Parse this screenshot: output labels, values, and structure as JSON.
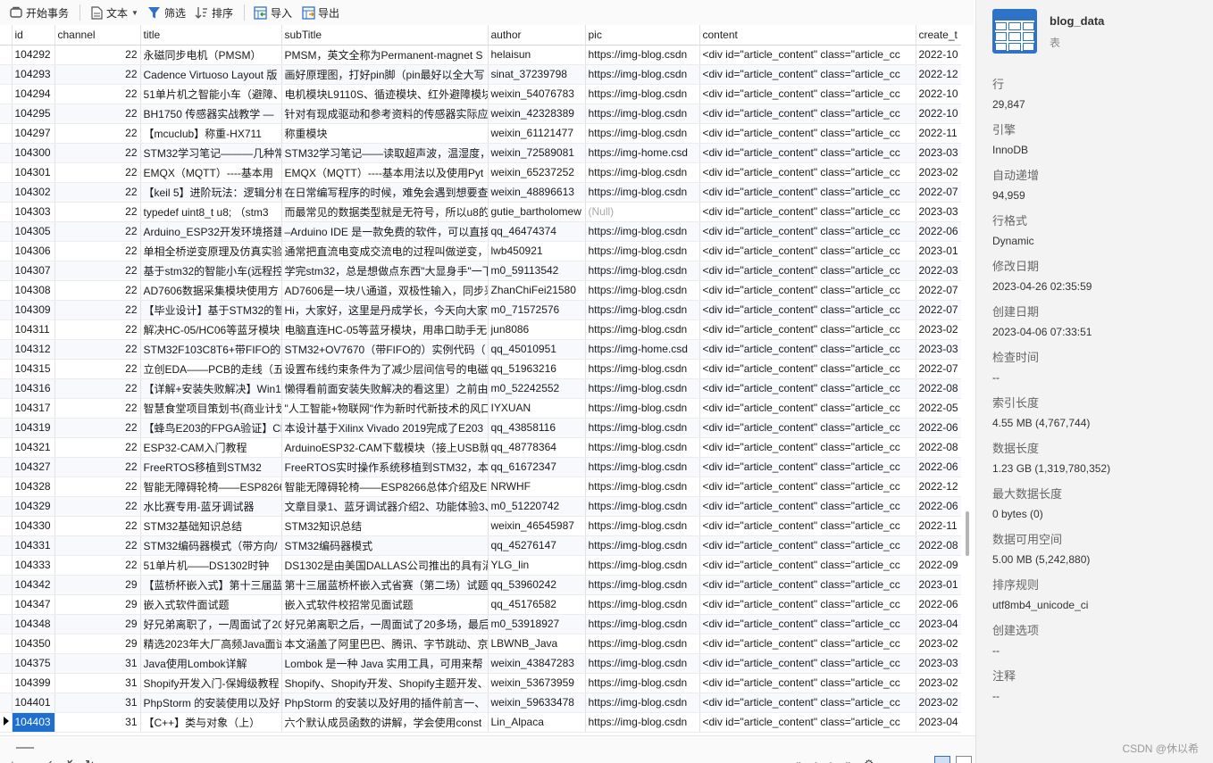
{
  "toolbar": {
    "begin_tx": "开始事务",
    "text": "文本",
    "filter": "筛选",
    "sort": "排序",
    "import": "导入",
    "export": "导出"
  },
  "grid": {
    "columns": [
      "id",
      "channel",
      "title",
      "subTitle",
      "author",
      "pic",
      "content",
      "create_t"
    ],
    "rows": [
      [
        "104292",
        "22",
        "永磁同步电机（PMSM）",
        "PMSM，英文全称为Permanent-magnet S",
        "helaisun",
        "https://img-blog.csdn",
        "<div id=\"article_content\" class=\"article_cc",
        "2022-10"
      ],
      [
        "104293",
        "22",
        "Cadence Virtuoso Layout 版",
        "画好原理图，打好pin脚（pin最好以全大写",
        "sinat_37239798",
        "https://img-blog.csdn",
        "<div id=\"article_content\" class=\"article_cc",
        "2022-12"
      ],
      [
        "104294",
        "22",
        "51单片机之智能小车（避障、",
        "电机模块L9110S、循迹模块、红外避障模块",
        "weixin_54076783",
        "https://img-blog.csdn",
        "<div id=\"article_content\" class=\"article_cc",
        "2022-10"
      ],
      [
        "104295",
        "22",
        "BH1750 传感器实战教学 —",
        "针对有现成驱动和参考资料的传感器实际应",
        "weixin_42328389",
        "https://img-blog.csdn",
        "<div id=\"article_content\" class=\"article_cc",
        "2022-10"
      ],
      [
        "104297",
        "22",
        "【mcuclub】称重-HX711",
        "称重模块",
        "weixin_61121477",
        "https://img-blog.csdn",
        "<div id=\"article_content\" class=\"article_cc",
        "2022-11"
      ],
      [
        "104300",
        "22",
        "STM32学习笔记———几种常",
        "STM32学习笔记——读取超声波，温湿度，",
        "weixin_72589081",
        "https://img-home.csd",
        "<div id=\"article_content\" class=\"article_cc",
        "2023-03"
      ],
      [
        "104301",
        "22",
        "EMQX（MQTT）----基本用",
        "EMQX（MQTT）----基本用法以及使用Pyt",
        "weixin_65237252",
        "https://img-blog.csdn",
        "<div id=\"article_content\" class=\"article_cc",
        "2023-02"
      ],
      [
        "104302",
        "22",
        "【keil 5】进阶玩法：逻辑分析",
        "在日常编写程序的时候，难免会遇到想要查",
        "weixin_48896613",
        "https://img-blog.csdn",
        "<div id=\"article_content\" class=\"article_cc",
        "2022-07"
      ],
      [
        "104303",
        "22",
        "typedef uint8_t u8; （stm3",
        "而最常见的数据类型就是无符号，所以u8的",
        "gutie_bartholomew",
        "(Null)",
        "<div id=\"article_content\" class=\"article_cc",
        "2023-03"
      ],
      [
        "104305",
        "22",
        "Arduino_ESP32开发环境搭建",
        "–Arduino IDE 是一款免费的软件，可以直接",
        "qq_46474374",
        "https://img-blog.csdn",
        "<div id=\"article_content\" class=\"article_cc",
        "2022-06"
      ],
      [
        "104306",
        "22",
        "单相全桥逆变原理及仿真实验",
        "通常把直流电变成交流电的过程叫做逆变，",
        "lwb450921",
        "https://img-blog.csdn",
        "<div id=\"article_content\" class=\"article_cc",
        "2023-01"
      ],
      [
        "104307",
        "22",
        "基于stm32的智能小车(远程控",
        "学完stm32，总是想做点东西\"大显身手\"一下",
        "m0_59113542",
        "https://img-blog.csdn",
        "<div id=\"article_content\" class=\"article_cc",
        "2022-03"
      ],
      [
        "104308",
        "22",
        "AD7606数据采集模块使用方",
        "AD7606是一块八通道，双极性输入，同步采",
        "ZhanChiFei21580",
        "https://img-blog.csdn",
        "<div id=\"article_content\" class=\"article_cc",
        "2022-07"
      ],
      [
        "104309",
        "22",
        "【毕业设计】基于STM32的智",
        "Hi，大家好，这里是丹成学长，今天向大家",
        "m0_71572576",
        "https://img-blog.csdn",
        "<div id=\"article_content\" class=\"article_cc",
        "2022-07"
      ],
      [
        "104311",
        "22",
        "解决HC-05/HC06等蓝牙模块",
        "电脑直连HC-05等蓝牙模块，用串口助手无",
        "jun8086",
        "https://img-blog.csdn",
        "<div id=\"article_content\" class=\"article_cc",
        "2023-02"
      ],
      [
        "104312",
        "22",
        "STM32F103C8T6+带FIFO的",
        "STM32+OV7670（带FIFO的）实例代码（",
        "qq_45010951",
        "https://img-home.csd",
        "<div id=\"article_content\" class=\"article_cc",
        "2023-03"
      ],
      [
        "104315",
        "22",
        "立创EDA——PCB的走线（五",
        "设置布线约束条件为了减少层间信号的电磁",
        "qq_51963216",
        "https://img-blog.csdn",
        "<div id=\"article_content\" class=\"article_cc",
        "2022-07"
      ],
      [
        "104316",
        "22",
        "【详解+安装失败解决】Win10",
        "懒得看前面安装失败解决的看这里）之前由",
        "m0_52242552",
        "https://img-blog.csdn",
        "<div id=\"article_content\" class=\"article_cc",
        "2022-08"
      ],
      [
        "104317",
        "22",
        "智慧食堂项目策划书(商业计划",
        "\"人工智能+物联网\"作为新时代新技术的风口",
        "IYXUAN",
        "https://img-blog.csdn",
        "<div id=\"article_content\" class=\"article_cc",
        "2022-05"
      ],
      [
        "104319",
        "22",
        "【蜂鸟E203的FPGA验证】Ch",
        "本设计基于Xilinx Vivado 2019完成了E203",
        "qq_43858116",
        "https://img-blog.csdn",
        "<div id=\"article_content\" class=\"article_cc",
        "2022-06"
      ],
      [
        "104321",
        "22",
        "ESP32-CAM入门教程",
        "ArduinoESP32-CAM下载模块（接上USB就",
        "qq_48778364",
        "https://img-blog.csdn",
        "<div id=\"article_content\" class=\"article_cc",
        "2022-08"
      ],
      [
        "104327",
        "22",
        "FreeRTOS移植到STM32",
        "FreeRTOS实时操作系统移植到STM32，本",
        "qq_61672347",
        "https://img-blog.csdn",
        "<div id=\"article_content\" class=\"article_cc",
        "2022-06"
      ],
      [
        "104328",
        "22",
        "智能无障碍轮椅——ESP8266",
        "智能无障碍轮椅——ESP8266总体介绍及E",
        "NRWHF",
        "https://img-blog.csdn",
        "<div id=\"article_content\" class=\"article_cc",
        "2022-12"
      ],
      [
        "104329",
        "22",
        "水比赛专用-蓝牙调试器",
        "文章目录1、蓝牙调试器介绍2、功能体验3、",
        "m0_51220742",
        "https://img-blog.csdn",
        "<div id=\"article_content\" class=\"article_cc",
        "2022-06"
      ],
      [
        "104330",
        "22",
        "STM32基础知识总结",
        "STM32知识总结",
        "weixin_46545987",
        "https://img-blog.csdn",
        "<div id=\"article_content\" class=\"article_cc",
        "2022-11"
      ],
      [
        "104331",
        "22",
        "STM32编码器模式（带方向/",
        "STM32编码器模式",
        "qq_45276147",
        "https://img-blog.csdn",
        "<div id=\"article_content\" class=\"article_cc",
        "2022-08"
      ],
      [
        "104333",
        "22",
        "51单片机——DS1302时钟",
        "DS1302是由美国DALLAS公司推出的具有涓",
        "YLG_lin",
        "https://img-blog.csdn",
        "<div id=\"article_content\" class=\"article_cc",
        "2022-09"
      ],
      [
        "104342",
        "29",
        "【蓝桥杯嵌入式】第十三届蓝",
        "第十三届蓝桥杯嵌入式省赛（第二场）试题",
        "qq_53960242",
        "https://img-blog.csdn",
        "<div id=\"article_content\" class=\"article_cc",
        "2023-01"
      ],
      [
        "104347",
        "29",
        "嵌入式软件面试题",
        "嵌入式软件校招常见面试题",
        "qq_45176582",
        "https://img-blog.csdn",
        "<div id=\"article_content\" class=\"article_cc",
        "2022-06"
      ],
      [
        "104348",
        "29",
        "好兄弟离职了，一周面试了20",
        "好兄弟离职之后，一周面试了20多场，最后",
        "m0_53918927",
        "https://img-blog.csdn",
        "<div id=\"article_content\" class=\"article_cc",
        "2023-04"
      ],
      [
        "104350",
        "29",
        "精选2023年大厂高频Java面试",
        "本文涵盖了阿里巴巴、腾讯、字节跳动、京",
        "LBWNB_Java",
        "https://img-blog.csdn",
        "<div id=\"article_content\" class=\"article_cc",
        "2023-02"
      ],
      [
        "104375",
        "31",
        "Java使用Lombok详解",
        "Lombok 是一种 Java 实用工具，可用来帮",
        "weixin_43847283",
        "https://img-blog.csdn",
        "<div id=\"article_content\" class=\"article_cc",
        "2023-03"
      ],
      [
        "104399",
        "31",
        "Shopify开发入门-保姆级教程",
        "Shopify、Shopify开发、Shopify主题开发、",
        "weixin_53673959",
        "https://img-blog.csdn",
        "<div id=\"article_content\" class=\"article_cc",
        "2023-02"
      ],
      [
        "104401",
        "31",
        "PhpStorm 的安装使用以及好",
        "PhpStorm 的安装以及好用的插件前言一、",
        "weixin_59633478",
        "https://img-blog.csdn",
        "<div id=\"article_content\" class=\"article_cc",
        "2023-02"
      ],
      [
        "104403",
        "31",
        "【C++】类与对象（上）",
        "六个默认成员函数的讲解，学会使用const",
        "Lin_Alpaca",
        "https://img-blog.csdn",
        "<div id=\"article_content\" class=\"article_cc",
        "2023-04"
      ]
    ],
    "selected_row_index": 34,
    "null_text": "(Null)"
  },
  "panel": {
    "table_name": "blog_data",
    "table_type": "表",
    "props": [
      {
        "label": "行",
        "value": "29,847"
      },
      {
        "label": "引擎",
        "value": "InnoDB"
      },
      {
        "label": "自动递增",
        "value": "94,959"
      },
      {
        "label": "行格式",
        "value": "Dynamic"
      },
      {
        "label": "修改日期",
        "value": "2023-04-26 02:35:59"
      },
      {
        "label": "创建日期",
        "value": "2023-04-06 07:33:51"
      },
      {
        "label": "检查时间",
        "value": "--"
      },
      {
        "label": "索引长度",
        "value": "4.55 MB (4,767,744)"
      },
      {
        "label": "数据长度",
        "value": "1.23 GB (1,319,780,352)"
      },
      {
        "label": "最大数据长度",
        "value": "0 bytes (0)"
      },
      {
        "label": "数据可用空间",
        "value": "5.00 MB (5,242,880)"
      },
      {
        "label": "排序规则",
        "value": "utf8mb4_unicode_ci"
      },
      {
        "label": "创建选项",
        "value": "--"
      },
      {
        "label": "注释",
        "value": "--"
      }
    ]
  },
  "watermark": "CSDN @休以希",
  "colors": {
    "accent": "#2f73c8",
    "selection": "#1f6fd1",
    "null_text": "#a8a8a8"
  }
}
